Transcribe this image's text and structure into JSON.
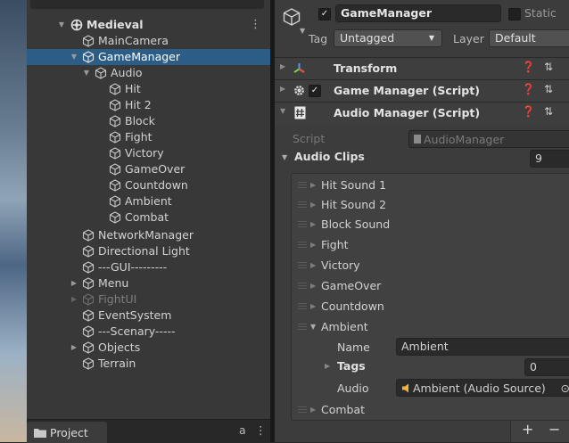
{
  "hierarchy": {
    "menu_icon": "kebab-menu-icon",
    "items": [
      {
        "label": "Medieval",
        "icon": "unity-scene-icon"
      },
      {
        "label": "MainCamera",
        "icon": "gameobject-icon"
      },
      {
        "label": "GameManager",
        "icon": "gameobject-icon"
      },
      {
        "label": "Audio",
        "icon": "gameobject-icon"
      },
      {
        "label": "Hit",
        "icon": "gameobject-icon"
      },
      {
        "label": "Hit 2",
        "icon": "gameobject-icon"
      },
      {
        "label": "Block",
        "icon": "gameobject-icon"
      },
      {
        "label": "Fight",
        "icon": "gameobject-icon"
      },
      {
        "label": "Victory",
        "icon": "gameobject-icon"
      },
      {
        "label": "GameOver",
        "icon": "gameobject-icon"
      },
      {
        "label": "Countdown",
        "icon": "gameobject-icon"
      },
      {
        "label": "Ambient",
        "icon": "gameobject-icon"
      },
      {
        "label": "Combat",
        "icon": "gameobject-icon"
      },
      {
        "label": "NetworkManager",
        "icon": "gameobject-icon"
      },
      {
        "label": "Directional Light",
        "icon": "gameobject-icon"
      },
      {
        "label": "---GUI---------",
        "icon": "gameobject-icon"
      },
      {
        "label": "Menu",
        "icon": "gameobject-icon"
      },
      {
        "label": "FightUI",
        "icon": "gameobject-icon"
      },
      {
        "label": "EventSystem",
        "icon": "gameobject-icon"
      },
      {
        "label": "---Scenary-----",
        "icon": "gameobject-icon"
      },
      {
        "label": "Objects",
        "icon": "gameobject-icon"
      },
      {
        "label": "Terrain",
        "icon": "gameobject-icon"
      }
    ],
    "selected_color": "#2c5d87"
  },
  "project_tab": {
    "label": "Project",
    "lock_glyph": "a",
    "menu_glyph": "⋮"
  },
  "inspector": {
    "object_name": "GameManager",
    "static_label": "Static",
    "tag_label": "Tag",
    "tag_value": "Untagged",
    "layer_label": "Layer",
    "layer_value": "Default",
    "components": {
      "transform": "Transform",
      "game_manager": "Game Manager (Script)",
      "audio_manager": "Audio Manager (Script)"
    },
    "script_label": "Script",
    "script_value": "AudioManager",
    "audio_clips_label": "Audio Clips",
    "audio_clips_count": "9",
    "clips": [
      "Hit Sound 1",
      "Hit Sound 2",
      "Block Sound",
      "Fight",
      "Victory",
      "GameOver",
      "Countdown"
    ],
    "ambient": {
      "label": "Ambient",
      "name_label": "Name",
      "name_value": "Ambient",
      "tags_label": "Tags",
      "tags_value": "0",
      "audio_label": "Audio",
      "audio_value": "Ambient (Audio Source)"
    },
    "last_clip": "Combat",
    "add_glyph": "+",
    "remove_glyph": "−"
  }
}
